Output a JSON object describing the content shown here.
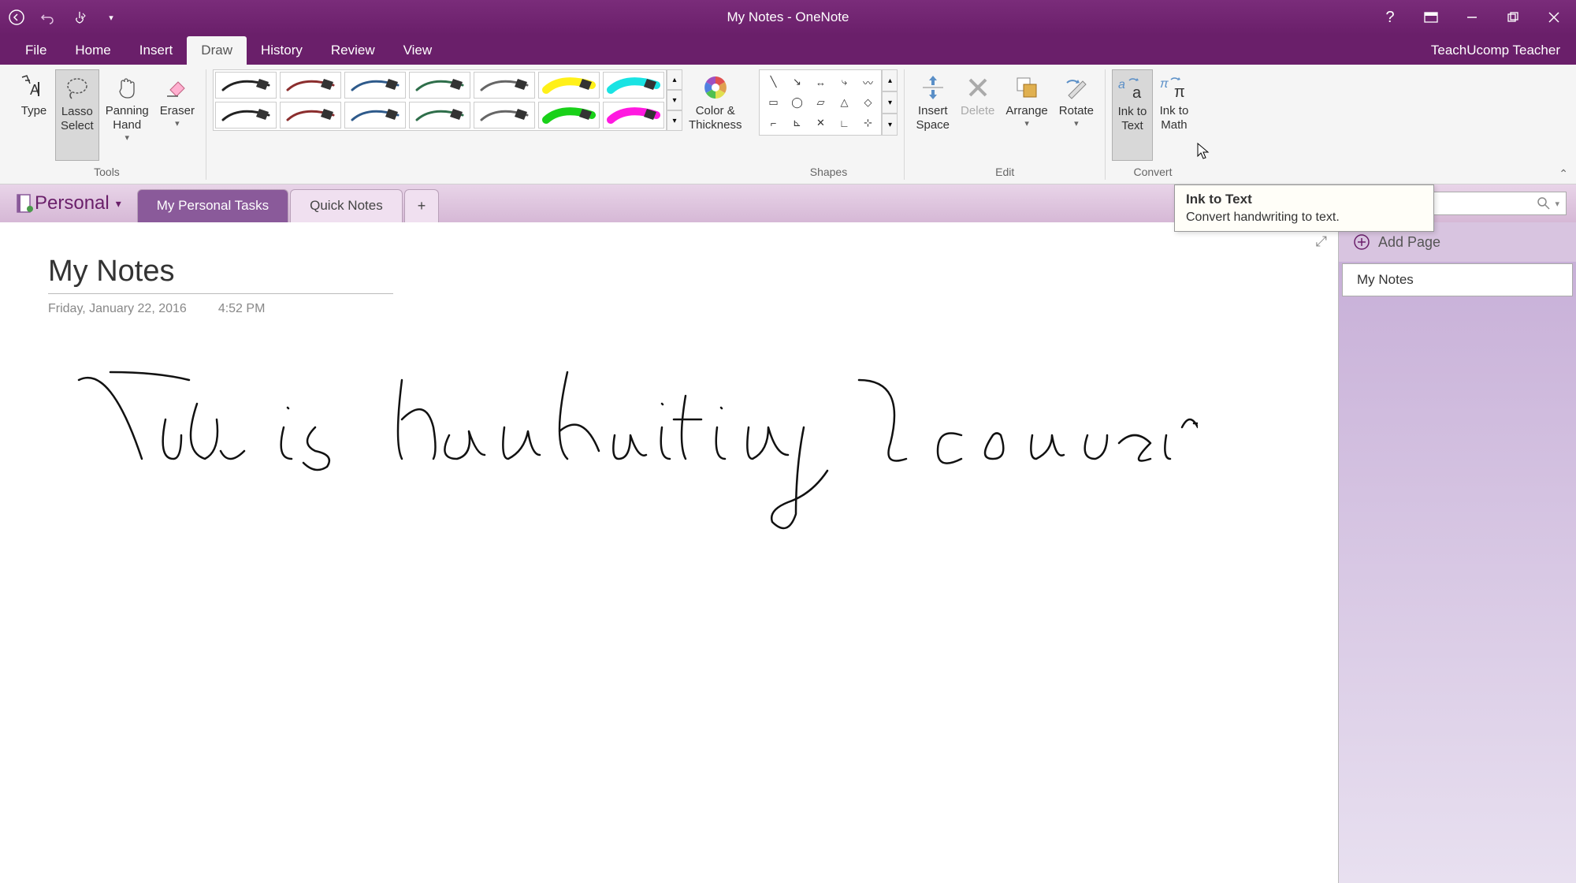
{
  "window": {
    "title": "My Notes - OneNote",
    "user": "TeachUcomp Teacher"
  },
  "menu_tabs": {
    "file": "File",
    "home": "Home",
    "insert": "Insert",
    "draw": "Draw",
    "history": "History",
    "review": "Review",
    "view": "View",
    "active": "Draw"
  },
  "ribbon": {
    "tools": {
      "label": "Tools",
      "type": "Type",
      "lasso": "Lasso\nSelect",
      "panning": "Panning\nHand",
      "eraser": "Eraser"
    },
    "pen_colors_row1": [
      "#222222",
      "#8b2e2e",
      "#2e5a8b",
      "#2e6e4a",
      "#666666",
      "#ffee00",
      "#00e0e0"
    ],
    "pen_colors_row2": [
      "#222222",
      "#8b2e2e",
      "#2e5a8b",
      "#2e6e4a",
      "#666666",
      "#00cc00",
      "#ff00dd"
    ],
    "color_thickness": "Color &\nThickness",
    "shapes": {
      "label": "Shapes"
    },
    "edit": {
      "label": "Edit",
      "insert_space": "Insert\nSpace",
      "delete": "Delete",
      "arrange": "Arrange",
      "rotate": "Rotate"
    },
    "convert": {
      "label": "Convert",
      "ink_to_text": "Ink to\nText",
      "ink_to_math": "Ink to\nMath"
    }
  },
  "tooltip": {
    "title": "Ink to Text",
    "desc": "Convert handwriting to text."
  },
  "notebook": {
    "name": "Personal",
    "sections": {
      "tasks": "My Personal Tasks",
      "quick": "Quick Notes"
    }
  },
  "page": {
    "title": "My Notes",
    "date": "Friday, January 22, 2016",
    "time": "4:52 PM",
    "handwriting_note": "This is handwriting I converted"
  },
  "page_list": {
    "add": "Add Page",
    "current": "My Notes"
  }
}
